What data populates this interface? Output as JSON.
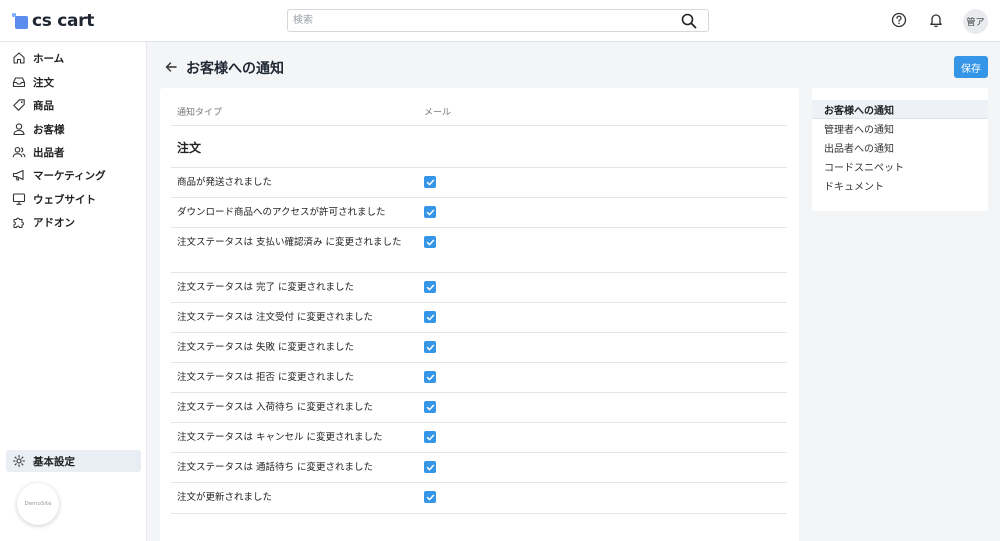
{
  "header": {
    "logo_text": "cs cart",
    "search_placeholder": "検索",
    "avatar_text": "管ア"
  },
  "sidebar": {
    "items": [
      {
        "label": "ホーム",
        "icon": "home-icon"
      },
      {
        "label": "注文",
        "icon": "inbox-icon"
      },
      {
        "label": "商品",
        "icon": "tag-icon"
      },
      {
        "label": "お客様",
        "icon": "user-icon"
      },
      {
        "label": "出品者",
        "icon": "users-icon"
      },
      {
        "label": "マーケティング",
        "icon": "megaphone-icon"
      },
      {
        "label": "ウェブサイト",
        "icon": "monitor-icon"
      },
      {
        "label": "アドオン",
        "icon": "puzzle-icon"
      }
    ],
    "settings_label": "基本設定",
    "demo_label": "DemoSite"
  },
  "page": {
    "title": "お客様への通知",
    "save_label": "保存",
    "col_type": "通知タイプ",
    "col_mail": "メール",
    "section_title": "注文"
  },
  "notifications": [
    {
      "label": "商品が発送されました",
      "email": true
    },
    {
      "label": "ダウンロード商品へのアクセスが許可されました",
      "email": true
    },
    {
      "label": "注文ステータスは 支払い確認済み に変更されました",
      "email": true
    },
    {
      "label": "注文ステータスは 完了 に変更されました",
      "email": true
    },
    {
      "label": "注文ステータスは 注文受付 に変更されました",
      "email": true
    },
    {
      "label": "注文ステータスは 失敗 に変更されました",
      "email": true
    },
    {
      "label": "注文ステータスは 拒否 に変更されました",
      "email": true
    },
    {
      "label": "注文ステータスは 入荷待ち に変更されました",
      "email": true
    },
    {
      "label": "注文ステータスは キャンセル に変更されました",
      "email": true
    },
    {
      "label": "注文ステータスは 通話待ち に変更されました",
      "email": true
    },
    {
      "label": "注文が更新されました",
      "email": true
    }
  ],
  "side_nav": {
    "items": [
      {
        "label": "お客様への通知",
        "active": true
      },
      {
        "label": "管理者への通知",
        "active": false
      },
      {
        "label": "出品者への通知",
        "active": false
      },
      {
        "label": "コードスニペット",
        "active": false
      },
      {
        "label": "ドキュメント",
        "active": false
      }
    ]
  },
  "colors": {
    "accent": "#3596e8",
    "sidebar_active": "#e9eef5"
  }
}
